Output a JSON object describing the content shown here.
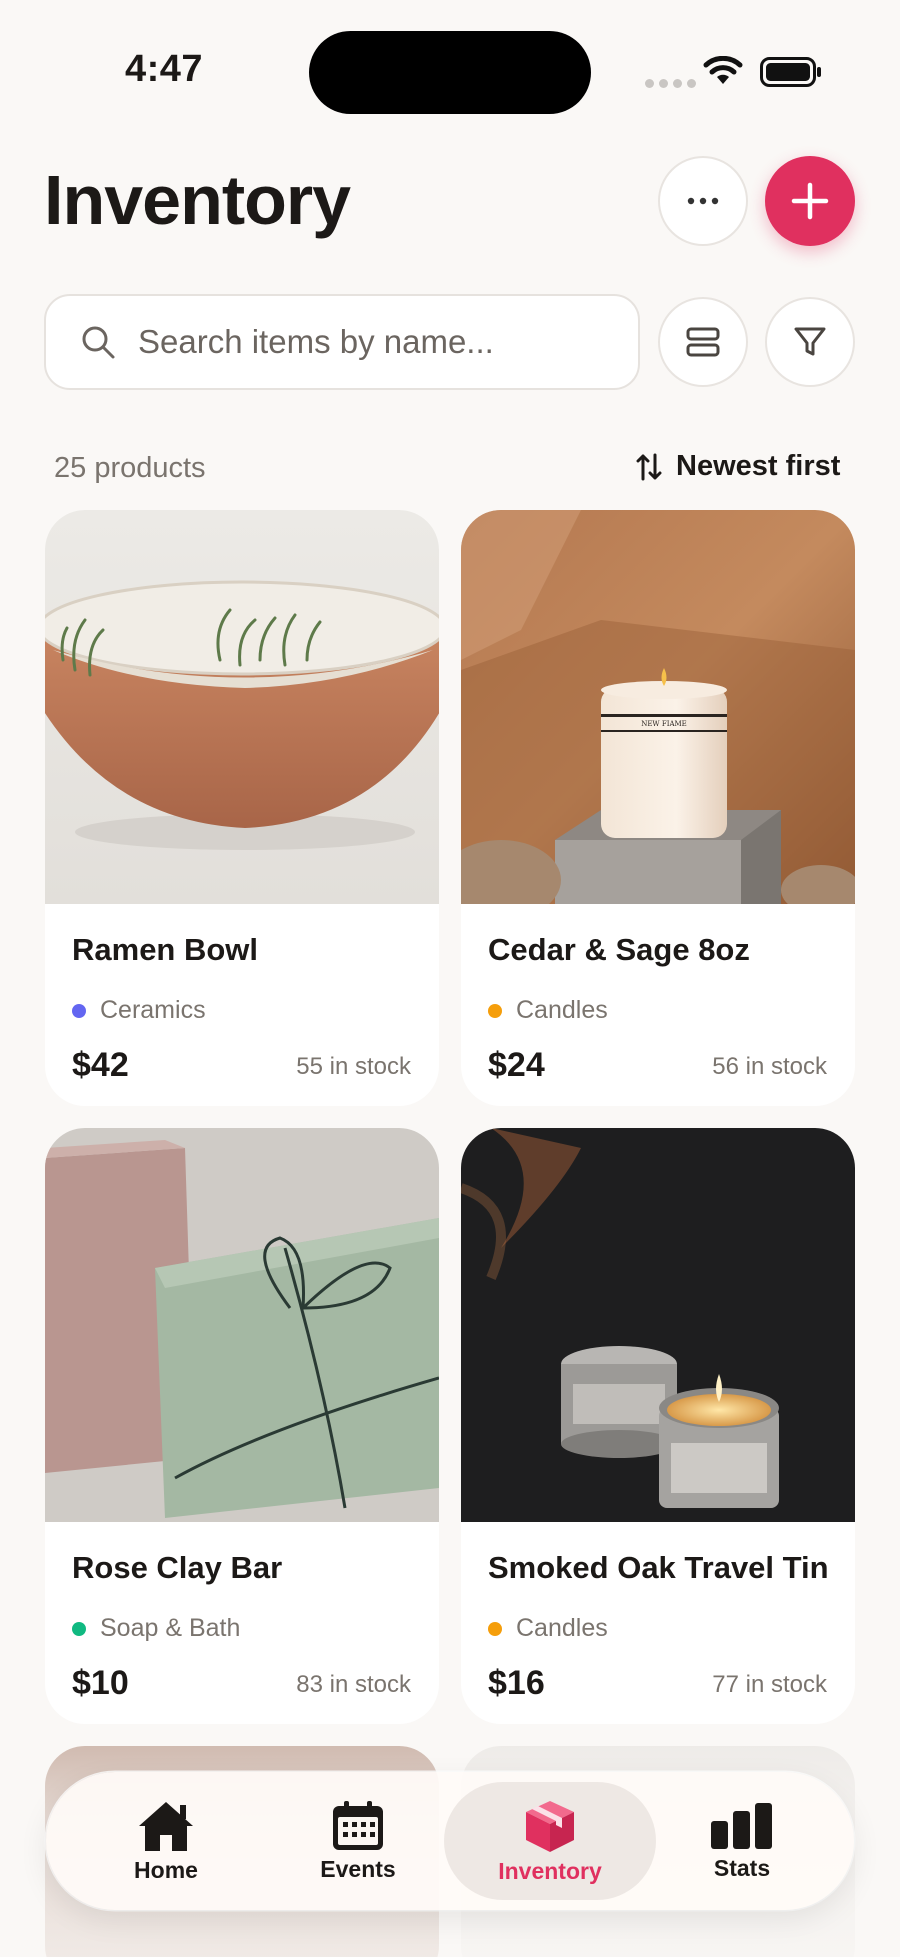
{
  "status_bar": {
    "time": "4:47"
  },
  "header": {
    "title": "Inventory"
  },
  "search": {
    "placeholder": "Search items by name..."
  },
  "list_meta": {
    "count_label": "25 products",
    "sort_label": "Newest first"
  },
  "colors": {
    "accent": "#e0305f",
    "category_ceramics": "#6366f1",
    "category_candles": "#f59e0b",
    "category_soap": "#10b981"
  },
  "products": [
    {
      "name": "Ramen Bowl",
      "category": "Ceramics",
      "category_color": "#6366f1",
      "price": "$42",
      "stock": "55 in stock",
      "image": "terracotta-bowl-photo"
    },
    {
      "name": "Cedar & Sage 8oz",
      "category": "Candles",
      "category_color": "#f59e0b",
      "price": "$24",
      "stock": "56 in stock",
      "image": "white-jar-candle-photo"
    },
    {
      "name": "Rose Clay Bar",
      "category": "Soap & Bath",
      "category_color": "#10b981",
      "price": "$10",
      "stock": "83 in stock",
      "image": "soap-bars-photo"
    },
    {
      "name": "Smoked Oak Travel Tin",
      "category": "Candles",
      "category_color": "#f59e0b",
      "price": "$16",
      "stock": "77 in stock",
      "image": "travel-tin-candles-photo"
    }
  ],
  "bottom_nav": {
    "items": [
      {
        "label": "Home",
        "icon": "house-icon",
        "active": false
      },
      {
        "label": "Events",
        "icon": "calendar-icon",
        "active": false
      },
      {
        "label": "Inventory",
        "icon": "box-icon",
        "active": true
      },
      {
        "label": "Stats",
        "icon": "bar-chart-icon",
        "active": false
      }
    ]
  }
}
